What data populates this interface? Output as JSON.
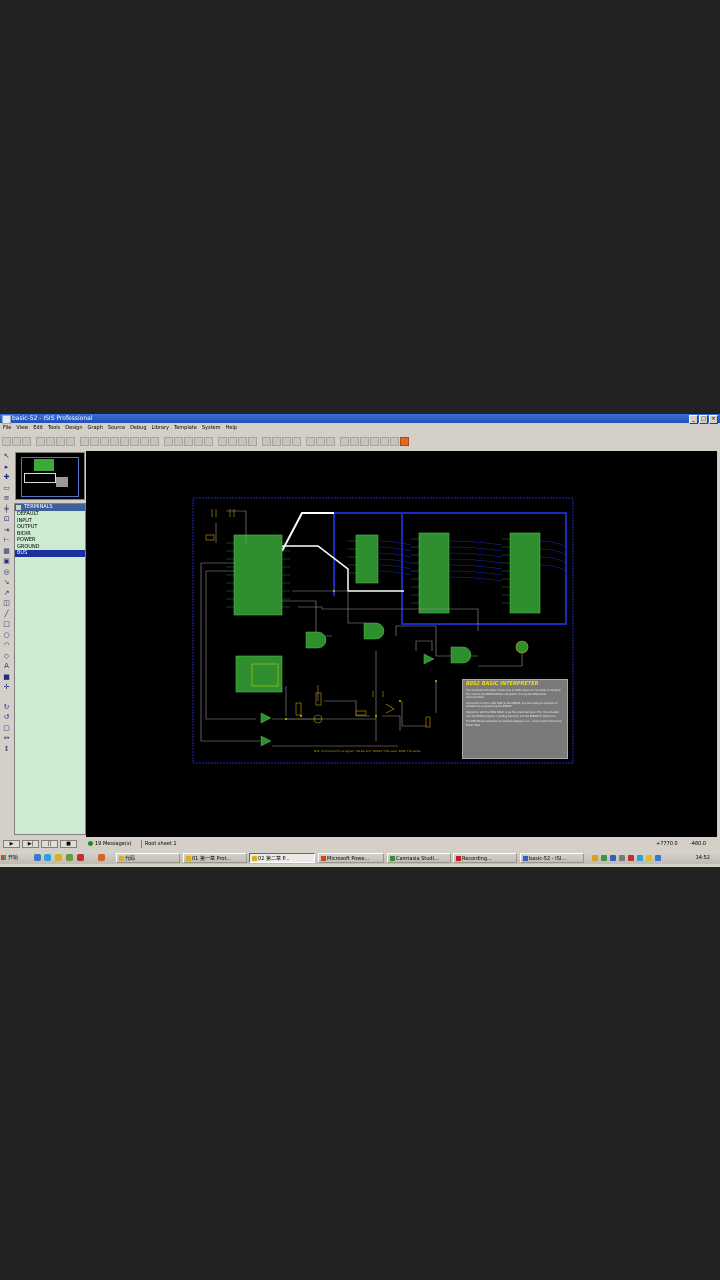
{
  "window": {
    "title": "basic-52 - ISIS Professional",
    "controls": [
      "_",
      "□",
      "×"
    ]
  },
  "menu": [
    "File",
    "View",
    "Edit",
    "Tools",
    "Design",
    "Graph",
    "Source",
    "Debug",
    "Library",
    "Template",
    "System",
    "Help"
  ],
  "device_panel": {
    "header": "TERMINALS",
    "items": [
      "DEFAULT",
      "INPUT",
      "OUTPUT",
      "BIDIR",
      "POWER",
      "GROUND",
      "BUS"
    ],
    "selected": "BUS"
  },
  "schematic": {
    "note_title": "8052 BASIC INTERPRETER",
    "note_paragraphs": [
      "This schematic/simulation shows how an 8052 device is connected to interpret the code for the 8052AH-BASIC interpreter running the 8052 series microcontroller.",
      "Connection is from a 32K RAM, to the EPROM, and the analog to set/down to activate the programming the EPROM.",
      "Interaction with the 8052 BASIC is via the virtual terminal. HT1. The simulator runs the BASIC program, including the timer and the EPROM for Writes too.",
      "The EPROM will remember its contents between runs - click to select the Virtual Model Table"
    ],
    "caption": "N.B. Command to program 74LS4 and '8052C' this sets 'RUN' F/A write."
  },
  "status": {
    "messages": "19 Message(s)",
    "sheet": "Root sheet 1",
    "coord_x": "+7770.0",
    "coord_y": "-460.0",
    "play_controls": [
      "▶",
      "▶|",
      "||",
      "■"
    ]
  },
  "taskbar": {
    "start": "开始",
    "tasks": [
      {
        "label": "代码",
        "active": false
      },
      {
        "label": "01 第一章 Prot...",
        "active": false
      },
      {
        "label": "02 第二章 P...",
        "active": true
      },
      {
        "label": "Microsoft Powe...",
        "active": false
      },
      {
        "label": "Camtasia Studi...",
        "active": false
      },
      {
        "label": "Recording...",
        "active": false
      },
      {
        "label": "basic-52 - ISI...",
        "active": false
      }
    ],
    "clock": "14:52"
  },
  "colors": {
    "canvas": "#000000",
    "chip": "#2f8f2f",
    "bus": "#1a2ac0",
    "accent": "#f2e200"
  }
}
